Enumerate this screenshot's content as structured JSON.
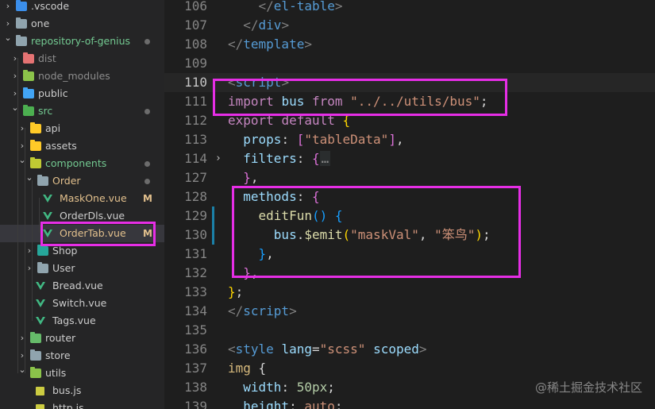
{
  "explorer": {
    "items": [
      {
        "label": ".vscode",
        "depth": 0,
        "kind": "folder",
        "open": false,
        "icon": "vscode-folder-icon",
        "color": "#3b8eea",
        "status": ""
      },
      {
        "label": "one",
        "depth": 0,
        "kind": "folder",
        "open": false,
        "icon": "folder-icon",
        "color": "#90a4ae",
        "status": ""
      },
      {
        "label": "repository-of-genius",
        "depth": 0,
        "kind": "folder",
        "open": true,
        "icon": "folder-icon",
        "color": "#90a4ae",
        "status": "dot",
        "labelColor": "#73c991"
      },
      {
        "label": "dist",
        "depth": 1,
        "kind": "folder",
        "open": false,
        "icon": "dist-folder-icon",
        "color": "#e57373",
        "status": "",
        "labelColor": "#8c8c8c"
      },
      {
        "label": "node_modules",
        "depth": 1,
        "kind": "folder",
        "open": false,
        "icon": "node-folder-icon",
        "color": "#8bc34a",
        "status": "",
        "labelColor": "#8c8c8c"
      },
      {
        "label": "public",
        "depth": 1,
        "kind": "folder",
        "open": false,
        "icon": "public-folder-icon",
        "color": "#42a5f5",
        "status": ""
      },
      {
        "label": "src",
        "depth": 1,
        "kind": "folder",
        "open": true,
        "icon": "src-folder-icon",
        "color": "#4caf50",
        "status": "dot",
        "labelColor": "#73c991"
      },
      {
        "label": "api",
        "depth": 2,
        "kind": "folder",
        "open": false,
        "icon": "api-folder-icon",
        "color": "#ffca28",
        "status": ""
      },
      {
        "label": "assets",
        "depth": 2,
        "kind": "folder",
        "open": false,
        "icon": "assets-folder-icon",
        "color": "#ffca28",
        "status": ""
      },
      {
        "label": "components",
        "depth": 2,
        "kind": "folder",
        "open": true,
        "icon": "components-folder-icon",
        "color": "#c0ca33",
        "status": "dot",
        "labelColor": "#73c991"
      },
      {
        "label": "Order",
        "depth": 3,
        "kind": "folder",
        "open": true,
        "icon": "folder-icon",
        "color": "#90a4ae",
        "status": "dot",
        "labelColor": "#e2c08d"
      },
      {
        "label": "MaskOne.vue",
        "depth": 4,
        "kind": "vue",
        "status": "M",
        "labelColor": "#e2c08d"
      },
      {
        "label": "OrderDls.vue",
        "depth": 4,
        "kind": "vue",
        "status": ""
      },
      {
        "label": "OrderTab.vue",
        "depth": 4,
        "kind": "vue",
        "status": "M",
        "labelColor": "#e2c08d",
        "selected": true
      },
      {
        "label": "Shop",
        "depth": 3,
        "kind": "folder",
        "open": false,
        "icon": "shop-folder-icon",
        "color": "#26a69a",
        "status": ""
      },
      {
        "label": "User",
        "depth": 3,
        "kind": "folder",
        "open": false,
        "icon": "folder-icon",
        "color": "#90a4ae",
        "status": ""
      },
      {
        "label": "Bread.vue",
        "depth": 3,
        "kind": "vue",
        "status": ""
      },
      {
        "label": "Switch.vue",
        "depth": 3,
        "kind": "vue",
        "status": ""
      },
      {
        "label": "Tags.vue",
        "depth": 3,
        "kind": "vue",
        "status": ""
      },
      {
        "label": "router",
        "depth": 2,
        "kind": "folder",
        "open": false,
        "icon": "router-folder-icon",
        "color": "#66bb6a",
        "status": ""
      },
      {
        "label": "store",
        "depth": 2,
        "kind": "folder",
        "open": false,
        "icon": "store-folder-icon",
        "color": "#90a4ae",
        "status": ""
      },
      {
        "label": "utils",
        "depth": 2,
        "kind": "folder",
        "open": true,
        "icon": "utils-folder-icon",
        "color": "#8bc34a",
        "status": ""
      },
      {
        "label": "bus.js",
        "depth": 3,
        "kind": "js",
        "status": ""
      },
      {
        "label": "http.js",
        "depth": 3,
        "kind": "js",
        "status": ""
      }
    ]
  },
  "editor": {
    "lines": [
      {
        "n": "106",
        "tokens": [
          [
            "    ",
            "t-p"
          ],
          [
            "</",
            "t-tag"
          ],
          [
            "el-table",
            "t-tagname"
          ],
          [
            ">",
            "t-tag"
          ]
        ]
      },
      {
        "n": "107",
        "tokens": [
          [
            "  ",
            "t-p"
          ],
          [
            "</",
            "t-tag"
          ],
          [
            "div",
            "t-tagname"
          ],
          [
            ">",
            "t-tag"
          ]
        ]
      },
      {
        "n": "108",
        "tokens": [
          [
            "</",
            "t-tag"
          ],
          [
            "template",
            "t-tagname"
          ],
          [
            ">",
            "t-tag"
          ]
        ]
      },
      {
        "n": "109",
        "tokens": []
      },
      {
        "n": "110",
        "active": true,
        "current": true,
        "tokens": [
          [
            "<",
            "t-tag"
          ],
          [
            "script",
            "t-tagname"
          ],
          [
            ">",
            "t-tag"
          ]
        ]
      },
      {
        "n": "111",
        "tokens": [
          [
            "import",
            "t-kw"
          ],
          [
            " ",
            "t-p"
          ],
          [
            "bus",
            "t-id"
          ],
          [
            " ",
            "t-p"
          ],
          [
            "from",
            "t-kw"
          ],
          [
            " ",
            "t-p"
          ],
          [
            "\"../../utils/bus\"",
            "t-str"
          ],
          [
            ";",
            "t-p"
          ]
        ]
      },
      {
        "n": "112",
        "tokens": [
          [
            "export",
            "t-kw"
          ],
          [
            " ",
            "t-p"
          ],
          [
            "default",
            "t-kw"
          ],
          [
            " ",
            "t-p"
          ],
          [
            "{",
            "t-br1"
          ]
        ]
      },
      {
        "n": "113",
        "tokens": [
          [
            "  ",
            "t-p"
          ],
          [
            "props",
            "t-id"
          ],
          [
            ": ",
            "t-p"
          ],
          [
            "[",
            "t-br2"
          ],
          [
            "\"tableData\"",
            "t-str"
          ],
          [
            "]",
            "t-br2"
          ],
          [
            ",",
            "t-p"
          ]
        ]
      },
      {
        "n": "114",
        "fold": true,
        "folded": true,
        "tokens": [
          [
            "  ",
            "t-p"
          ],
          [
            "filters",
            "t-id"
          ],
          [
            ": ",
            "t-p"
          ],
          [
            "{",
            "t-br2"
          ],
          [
            "…",
            "ellipsis"
          ]
        ]
      },
      {
        "n": "127",
        "tokens": [
          [
            "  ",
            "t-p"
          ],
          [
            "}",
            "t-br2"
          ],
          [
            ",",
            "t-p"
          ]
        ]
      },
      {
        "n": "128",
        "tokens": [
          [
            "  ",
            "t-p"
          ],
          [
            "methods",
            "t-id"
          ],
          [
            ": ",
            "t-p"
          ],
          [
            "{",
            "t-br2"
          ]
        ]
      },
      {
        "n": "129",
        "modified": true,
        "tokens": [
          [
            "    ",
            "t-p"
          ],
          [
            "editFun",
            "t-fn"
          ],
          [
            "()",
            "t-br3"
          ],
          [
            " ",
            "t-p"
          ],
          [
            "{",
            "t-br3"
          ]
        ]
      },
      {
        "n": "130",
        "modified": true,
        "tokens": [
          [
            "      ",
            "t-p"
          ],
          [
            "bus",
            "t-id"
          ],
          [
            ".",
            "t-p"
          ],
          [
            "$emit",
            "t-fn"
          ],
          [
            "(",
            "t-br1"
          ],
          [
            "\"maskVal\"",
            "t-str"
          ],
          [
            ", ",
            "t-p"
          ],
          [
            "\"笨鸟\"",
            "t-str"
          ],
          [
            ")",
            "t-br1"
          ],
          [
            ";",
            "t-p"
          ]
        ]
      },
      {
        "n": "131",
        "tokens": [
          [
            "    ",
            "t-p"
          ],
          [
            "}",
            "t-br3"
          ],
          [
            ",",
            "t-p"
          ]
        ]
      },
      {
        "n": "132",
        "tokens": [
          [
            "  ",
            "t-p"
          ],
          [
            "}",
            "t-br2"
          ],
          [
            ",",
            "t-p"
          ]
        ]
      },
      {
        "n": "133",
        "tokens": [
          [
            "}",
            "t-br1"
          ],
          [
            ";",
            "t-p"
          ]
        ]
      },
      {
        "n": "134",
        "tokens": [
          [
            "</",
            "t-tag"
          ],
          [
            "script",
            "t-tagname"
          ],
          [
            ">",
            "t-tag"
          ]
        ]
      },
      {
        "n": "135",
        "tokens": []
      },
      {
        "n": "136",
        "tokens": [
          [
            "<",
            "t-tag"
          ],
          [
            "style",
            "t-tagname"
          ],
          [
            " ",
            "t-p"
          ],
          [
            "lang",
            "t-attr"
          ],
          [
            "=",
            "t-p"
          ],
          [
            "\"scss\"",
            "t-str"
          ],
          [
            " ",
            "t-p"
          ],
          [
            "scoped",
            "t-attr"
          ],
          [
            ">",
            "t-tag"
          ]
        ]
      },
      {
        "n": "137",
        "tokens": [
          [
            "img",
            "t-css"
          ],
          [
            " ",
            "t-p"
          ],
          [
            "{",
            "t-p"
          ]
        ]
      },
      {
        "n": "138",
        "tokens": [
          [
            "  ",
            "t-p"
          ],
          [
            "width",
            "t-id"
          ],
          [
            ": ",
            "t-p"
          ],
          [
            "50px",
            "t-num"
          ],
          [
            ";",
            "t-p"
          ]
        ]
      },
      {
        "n": "139",
        "tokens": [
          [
            "  ",
            "t-p"
          ],
          [
            "height",
            "t-id"
          ],
          [
            ": ",
            "t-p"
          ],
          [
            "auto",
            "t-str"
          ],
          [
            ";",
            "t-p"
          ]
        ]
      }
    ]
  },
  "highlight_color": "#e62ee6",
  "watermark": "@稀土掘金技术社区"
}
